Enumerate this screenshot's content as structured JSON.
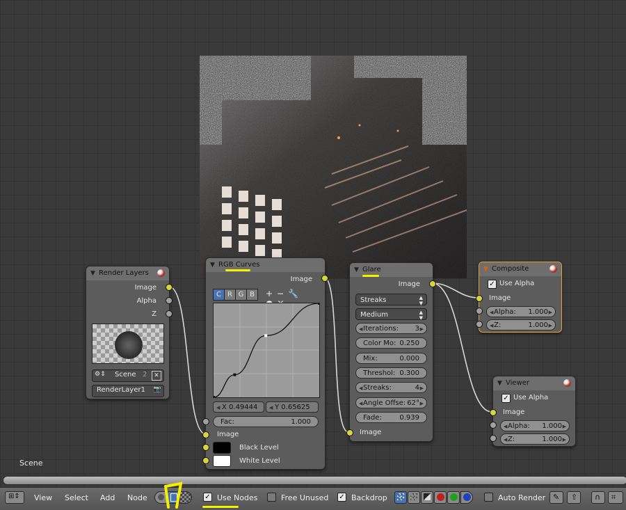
{
  "scene_label": "Scene",
  "nodes": {
    "render_layers": {
      "title": "Render Layers",
      "outputs": [
        "Image",
        "Alpha",
        "Z"
      ],
      "scene_name": "Scene",
      "scene_users": "2",
      "layer_name": "RenderLayer1"
    },
    "rgb_curves": {
      "title": "RGB Curves",
      "output": "Image",
      "channels": [
        "C",
        "R",
        "G",
        "B"
      ],
      "tools": [
        "+",
        "−",
        "🔧",
        "●",
        "✕"
      ],
      "x_label": "X 0.49444",
      "y_label": "Y 0.65625",
      "fac_label": "Fac:",
      "fac_value": "1.000",
      "inputs": [
        "Image",
        "Black Level",
        "White Level"
      ],
      "curve_points": [
        [
          0,
          0
        ],
        [
          0.2,
          0.24
        ],
        [
          0.49444,
          0.65625
        ],
        [
          1,
          1
        ]
      ]
    },
    "glare": {
      "title": "Glare",
      "output": "Image",
      "type": "Streaks",
      "quality": "Medium",
      "params": [
        {
          "k": "Iterations:",
          "v": "3"
        },
        {
          "k": "Color Mo:",
          "v": "0.250"
        },
        {
          "k": "Mix:",
          "v": "0.000"
        },
        {
          "k": "Threshol:",
          "v": "0.300"
        },
        {
          "k": "Streaks:",
          "v": "4"
        },
        {
          "k": "Angle Offse:",
          "v": "62°"
        },
        {
          "k": "Fade:",
          "v": "0.939"
        }
      ],
      "input": "Image"
    },
    "composite": {
      "title": "Composite",
      "use_alpha": "Use Alpha",
      "input": "Image",
      "alpha_label": "Alpha:",
      "alpha_value": "1.000",
      "z_label": "Z:",
      "z_value": "1.000"
    },
    "viewer": {
      "title": "Viewer",
      "use_alpha": "Use Alpha",
      "input": "Image",
      "alpha_label": "Alpha:",
      "alpha_value": "1.000",
      "z_label": "Z:",
      "z_value": "1.000"
    }
  },
  "toolbar": {
    "menus": [
      "View",
      "Select",
      "Add",
      "Node"
    ],
    "use_nodes": "Use Nodes",
    "free_unused": "Free Unused",
    "backdrop": "Backdrop",
    "auto_render": "Auto Render"
  },
  "colors": {
    "socket_image": "#d6d63c",
    "socket_value": "#a0a0a0",
    "highlight": "#f3f000",
    "selected_outline": "#f0a030"
  }
}
